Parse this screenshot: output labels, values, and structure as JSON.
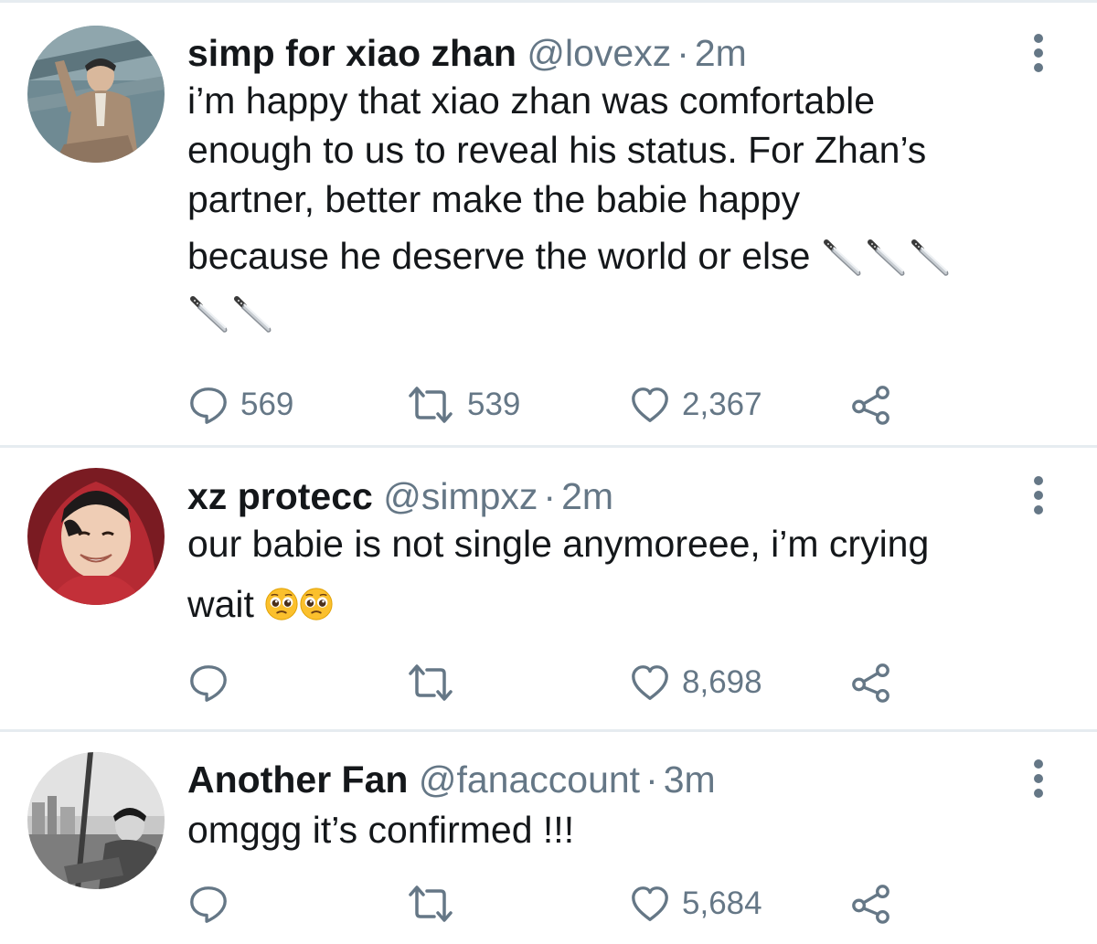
{
  "tweets": [
    {
      "name": "simp for xiao zhan",
      "handle": "@lovexz",
      "separator": "·",
      "time": "2m",
      "lines": [
        "i’m happy that xiao zhan was comfortable",
        "enough to us to reveal his status. For Zhan’s",
        "partner, better make the babie happy",
        "because he deserve the world or else",
        ""
      ],
      "emoji": "knife-emoji",
      "replies": "569",
      "retweets": "539",
      "likes": "2,367"
    },
    {
      "name": "xz protecc",
      "handle": "@simpxz",
      "separator": "·",
      "time": "2m",
      "lines": [
        "our babie is not single anymoreee, i’m crying",
        "wait"
      ],
      "emoji": "pleading-face-emoji",
      "replies": "",
      "retweets": "",
      "likes": "8,698"
    },
    {
      "name": "Another Fan",
      "handle": "@fanaccount",
      "separator": "·",
      "time": "3m",
      "lines": [
        "omggg it’s confirmed !!!"
      ],
      "replies": "",
      "retweets": "",
      "likes": "5,684"
    }
  ],
  "icons": {
    "reply": "reply-icon",
    "retweet": "retweet-icon",
    "like": "heart-icon",
    "share": "share-icon",
    "more": "more-vertical-icon"
  },
  "colors": {
    "text": "#14171a",
    "secondary": "#657786",
    "divider": "#e6ecf0"
  }
}
